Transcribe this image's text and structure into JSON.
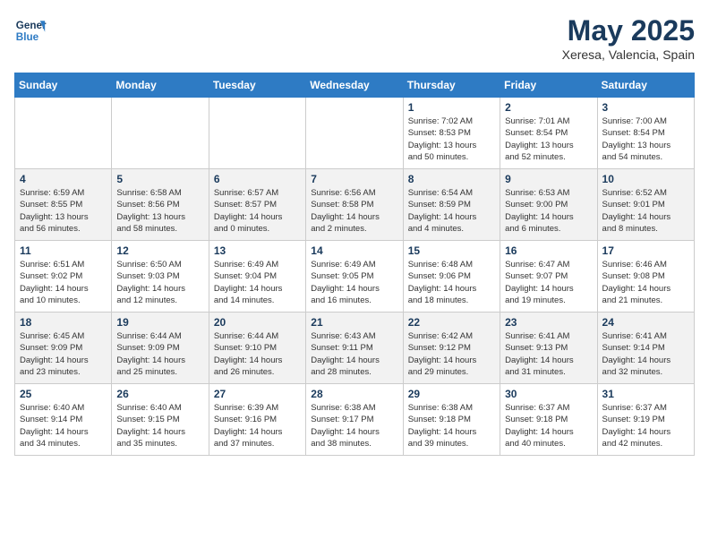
{
  "header": {
    "logo_line1": "General",
    "logo_line2": "Blue",
    "title": "May 2025",
    "subtitle": "Xeresa, Valencia, Spain"
  },
  "days_of_week": [
    "Sunday",
    "Monday",
    "Tuesday",
    "Wednesday",
    "Thursday",
    "Friday",
    "Saturday"
  ],
  "weeks": [
    [
      {
        "day": "",
        "info": ""
      },
      {
        "day": "",
        "info": ""
      },
      {
        "day": "",
        "info": ""
      },
      {
        "day": "",
        "info": ""
      },
      {
        "day": "1",
        "info": "Sunrise: 7:02 AM\nSunset: 8:53 PM\nDaylight: 13 hours\nand 50 minutes."
      },
      {
        "day": "2",
        "info": "Sunrise: 7:01 AM\nSunset: 8:54 PM\nDaylight: 13 hours\nand 52 minutes."
      },
      {
        "day": "3",
        "info": "Sunrise: 7:00 AM\nSunset: 8:54 PM\nDaylight: 13 hours\nand 54 minutes."
      }
    ],
    [
      {
        "day": "4",
        "info": "Sunrise: 6:59 AM\nSunset: 8:55 PM\nDaylight: 13 hours\nand 56 minutes."
      },
      {
        "day": "5",
        "info": "Sunrise: 6:58 AM\nSunset: 8:56 PM\nDaylight: 13 hours\nand 58 minutes."
      },
      {
        "day": "6",
        "info": "Sunrise: 6:57 AM\nSunset: 8:57 PM\nDaylight: 14 hours\nand 0 minutes."
      },
      {
        "day": "7",
        "info": "Sunrise: 6:56 AM\nSunset: 8:58 PM\nDaylight: 14 hours\nand 2 minutes."
      },
      {
        "day": "8",
        "info": "Sunrise: 6:54 AM\nSunset: 8:59 PM\nDaylight: 14 hours\nand 4 minutes."
      },
      {
        "day": "9",
        "info": "Sunrise: 6:53 AM\nSunset: 9:00 PM\nDaylight: 14 hours\nand 6 minutes."
      },
      {
        "day": "10",
        "info": "Sunrise: 6:52 AM\nSunset: 9:01 PM\nDaylight: 14 hours\nand 8 minutes."
      }
    ],
    [
      {
        "day": "11",
        "info": "Sunrise: 6:51 AM\nSunset: 9:02 PM\nDaylight: 14 hours\nand 10 minutes."
      },
      {
        "day": "12",
        "info": "Sunrise: 6:50 AM\nSunset: 9:03 PM\nDaylight: 14 hours\nand 12 minutes."
      },
      {
        "day": "13",
        "info": "Sunrise: 6:49 AM\nSunset: 9:04 PM\nDaylight: 14 hours\nand 14 minutes."
      },
      {
        "day": "14",
        "info": "Sunrise: 6:49 AM\nSunset: 9:05 PM\nDaylight: 14 hours\nand 16 minutes."
      },
      {
        "day": "15",
        "info": "Sunrise: 6:48 AM\nSunset: 9:06 PM\nDaylight: 14 hours\nand 18 minutes."
      },
      {
        "day": "16",
        "info": "Sunrise: 6:47 AM\nSunset: 9:07 PM\nDaylight: 14 hours\nand 19 minutes."
      },
      {
        "day": "17",
        "info": "Sunrise: 6:46 AM\nSunset: 9:08 PM\nDaylight: 14 hours\nand 21 minutes."
      }
    ],
    [
      {
        "day": "18",
        "info": "Sunrise: 6:45 AM\nSunset: 9:09 PM\nDaylight: 14 hours\nand 23 minutes."
      },
      {
        "day": "19",
        "info": "Sunrise: 6:44 AM\nSunset: 9:09 PM\nDaylight: 14 hours\nand 25 minutes."
      },
      {
        "day": "20",
        "info": "Sunrise: 6:44 AM\nSunset: 9:10 PM\nDaylight: 14 hours\nand 26 minutes."
      },
      {
        "day": "21",
        "info": "Sunrise: 6:43 AM\nSunset: 9:11 PM\nDaylight: 14 hours\nand 28 minutes."
      },
      {
        "day": "22",
        "info": "Sunrise: 6:42 AM\nSunset: 9:12 PM\nDaylight: 14 hours\nand 29 minutes."
      },
      {
        "day": "23",
        "info": "Sunrise: 6:41 AM\nSunset: 9:13 PM\nDaylight: 14 hours\nand 31 minutes."
      },
      {
        "day": "24",
        "info": "Sunrise: 6:41 AM\nSunset: 9:14 PM\nDaylight: 14 hours\nand 32 minutes."
      }
    ],
    [
      {
        "day": "25",
        "info": "Sunrise: 6:40 AM\nSunset: 9:14 PM\nDaylight: 14 hours\nand 34 minutes."
      },
      {
        "day": "26",
        "info": "Sunrise: 6:40 AM\nSunset: 9:15 PM\nDaylight: 14 hours\nand 35 minutes."
      },
      {
        "day": "27",
        "info": "Sunrise: 6:39 AM\nSunset: 9:16 PM\nDaylight: 14 hours\nand 37 minutes."
      },
      {
        "day": "28",
        "info": "Sunrise: 6:38 AM\nSunset: 9:17 PM\nDaylight: 14 hours\nand 38 minutes."
      },
      {
        "day": "29",
        "info": "Sunrise: 6:38 AM\nSunset: 9:18 PM\nDaylight: 14 hours\nand 39 minutes."
      },
      {
        "day": "30",
        "info": "Sunrise: 6:37 AM\nSunset: 9:18 PM\nDaylight: 14 hours\nand 40 minutes."
      },
      {
        "day": "31",
        "info": "Sunrise: 6:37 AM\nSunset: 9:19 PM\nDaylight: 14 hours\nand 42 minutes."
      }
    ]
  ]
}
